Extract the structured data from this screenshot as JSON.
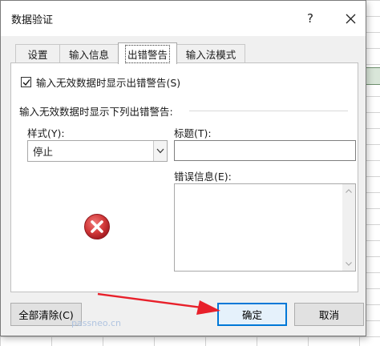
{
  "dialog": {
    "title": "数据验证",
    "help_label": "?"
  },
  "tabs": [
    {
      "label": "设置"
    },
    {
      "label": "输入信息"
    },
    {
      "label": "出错警告"
    },
    {
      "label": "输入法模式"
    }
  ],
  "error_alert": {
    "show_checkbox_label": "输入无效数据时显示出错警告(S)",
    "show_checked": true,
    "section_label": "输入无效数据时显示下列出错警告:",
    "style_label": "样式(Y):",
    "style_value": "停止",
    "title_label": "标题(T):",
    "title_value": "",
    "message_label": "错误信息(E):",
    "message_value": ""
  },
  "buttons": {
    "clear_all": "全部清除(C)",
    "ok": "确定",
    "cancel": "取消"
  },
  "watermark": "passneo.cn",
  "colors": {
    "stop_icon": "#c4262e",
    "annotation_arrow": "#e8202a",
    "focus_border": "#0078d7"
  }
}
